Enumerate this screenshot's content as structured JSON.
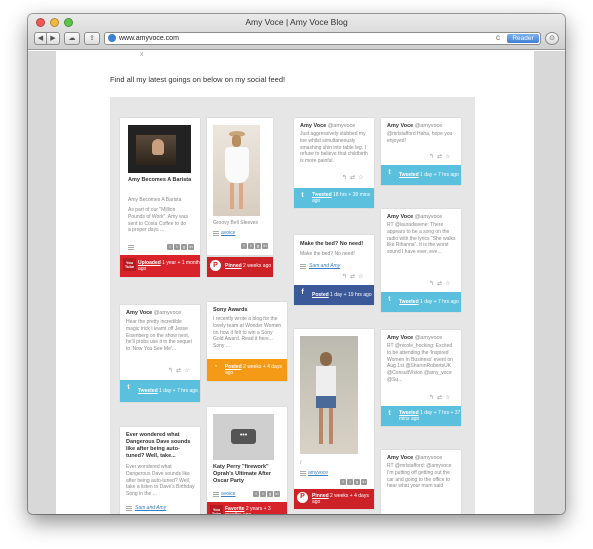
{
  "window": {
    "title": "Amy Voce | Amy Voce Blog",
    "url": "www.amyvoce.com",
    "reader_label": "Reader",
    "reload_symbol": "c",
    "traffic_lights": [
      "#ee5b57",
      "#f0b940",
      "#5cc64a"
    ]
  },
  "toolbar": {
    "back": "◀",
    "forward": "▶",
    "share": "⇪",
    "cloud": "☁",
    "download": "⊙"
  },
  "page": {
    "close_mark": "x",
    "heading": "Find all my latest goings on below on my social feed!"
  },
  "cards": {
    "c1": {
      "title": "Amy Becomes A Barista",
      "subtitle": "Amy Becomes A Barista",
      "text": "As part of our \"Million Pounds of Work\", Amy was sent to Costa Coffee to do a proper days ...",
      "footer_link": "Uploaded",
      "footer_rest": " 1 year + 1 month ago",
      "source_icon": "You Tube",
      "color": "#d8232a"
    },
    "c2": {
      "caption": "Groovy Bell Sleeves",
      "author": "avoice",
      "footer_link": "Pinned",
      "footer_rest": " 2 weeks ago",
      "source_icon": "P",
      "color": "#cc2127"
    },
    "c3": {
      "name": "Amy Voce",
      "handle": "@amyvoce",
      "text": "Just aggressively stubbed my toe whilst simultaneously smashing shin into table leg. I refuse to believe that childbirth is more painful.",
      "footer_link": "Tweeted",
      "footer_rest": " 18 hrs + 39 mins ago",
      "source_icon": "t",
      "color": "#5bc0de"
    },
    "c4": {
      "name": "Amy Voce",
      "handle": "@amyvoce",
      "mention": "@mrlstafford",
      "text": " Haha, hope you enjoyed!",
      "footer_link": "Tweeted",
      "footer_rest": " 1 day + 7 hrs ago",
      "source_icon": "t",
      "color": "#5bc0de"
    },
    "c5": {
      "title": "Make the bed? No need!",
      "text": "Make the bed? No need!",
      "author": "Sam and Amy",
      "footer_link": "Posted",
      "footer_rest": " 1 day + 19 hrs ago",
      "source_icon": "f",
      "color": "#3b5998"
    },
    "c6": {
      "name": "Amy Voce",
      "handle": "@amyvoce",
      "text_prefix": "RT ",
      "mention": "@lauradavene",
      "text": ": There appears to be a song on the radio with the lyrics \"She walks like Rihanna\". It is the worst sound I have ever, eve...",
      "footer_link": "Tweeted",
      "footer_rest": " 1 day + 7 hrs ago",
      "source_icon": "t",
      "color": "#5bc0de"
    },
    "c7": {
      "name": "Amy Voce",
      "handle": "@amyvoce",
      "text": "Hear the pretty incredible magic trick I learnt off Jesse Eisenberg on the show next, he'll probs use it in the sequel to 'Now You See Me'...",
      "footer_link": "Tweeted",
      "footer_rest": " 1 day + 7 hrs ago",
      "source_icon": "t",
      "color": "#5bc0de"
    },
    "c8": {
      "title": "Sony Awards",
      "text": "I recently wrote a blog for the lovely team at Wonder Women on how it felt to win a Sony Gold Award. Read it here... Sony ...",
      "footer_link": "Posted",
      "footer_rest": " 2 weeks + 4 days ago",
      "source_icon": "rss",
      "color": "#f59a16"
    },
    "c9": {
      "caption": "/",
      "author": "amyvoce",
      "footer_link": "Pinned",
      "footer_rest": " 2 weeks + 4 days ago",
      "source_icon": "P",
      "color": "#cc2127"
    },
    "c10": {
      "name": "Amy Voce",
      "handle": "@amyvoce",
      "text_prefix": "RT ",
      "mention": "@nicole_hocking",
      "text": ": Excited to be attending the 'Inspired Women In Business' event on Aug 1st ",
      "mentions2": "@SharonRobertsUK @ConsultVision @amy_voce @Su...",
      "footer_link": "Tweeted",
      "footer_rest": " 1 day + 7 hrs + 37 mins ago",
      "source_icon": "t",
      "color": "#5bc0de"
    },
    "c11": {
      "title": "Ever wondered what Dangerous Dave sounds like after being auto-tuned? Well, take...",
      "text": "Ever wondered what Dangerous Dave sounds like after being auto-tuned? Well, take a listen to Dave's Birthday Song in the ...",
      "author": "Sam and Amy",
      "color": "#3b5998"
    },
    "c12": {
      "title": "Katy Perry \"firework\" Oprah's Ultimate After Oscar Party",
      "author": "avoice",
      "footer_link": "Favorite",
      "footer_rest": " 2 years + 3 months ago",
      "source_icon": "You Tube",
      "color": "#d8232a"
    },
    "c13": {
      "name": "Amy Voce",
      "handle": "@amyvoce",
      "text_prefix": "RT ",
      "mention": "@mrlstafford",
      "mention2": "@amyvoce",
      "text": ": ",
      "text2": " I'm putting off getting out the car and going to the office to hear what your mum said",
      "color": "#5bc0de"
    }
  },
  "share_labels": [
    "f",
    "t",
    "g",
    "in"
  ]
}
